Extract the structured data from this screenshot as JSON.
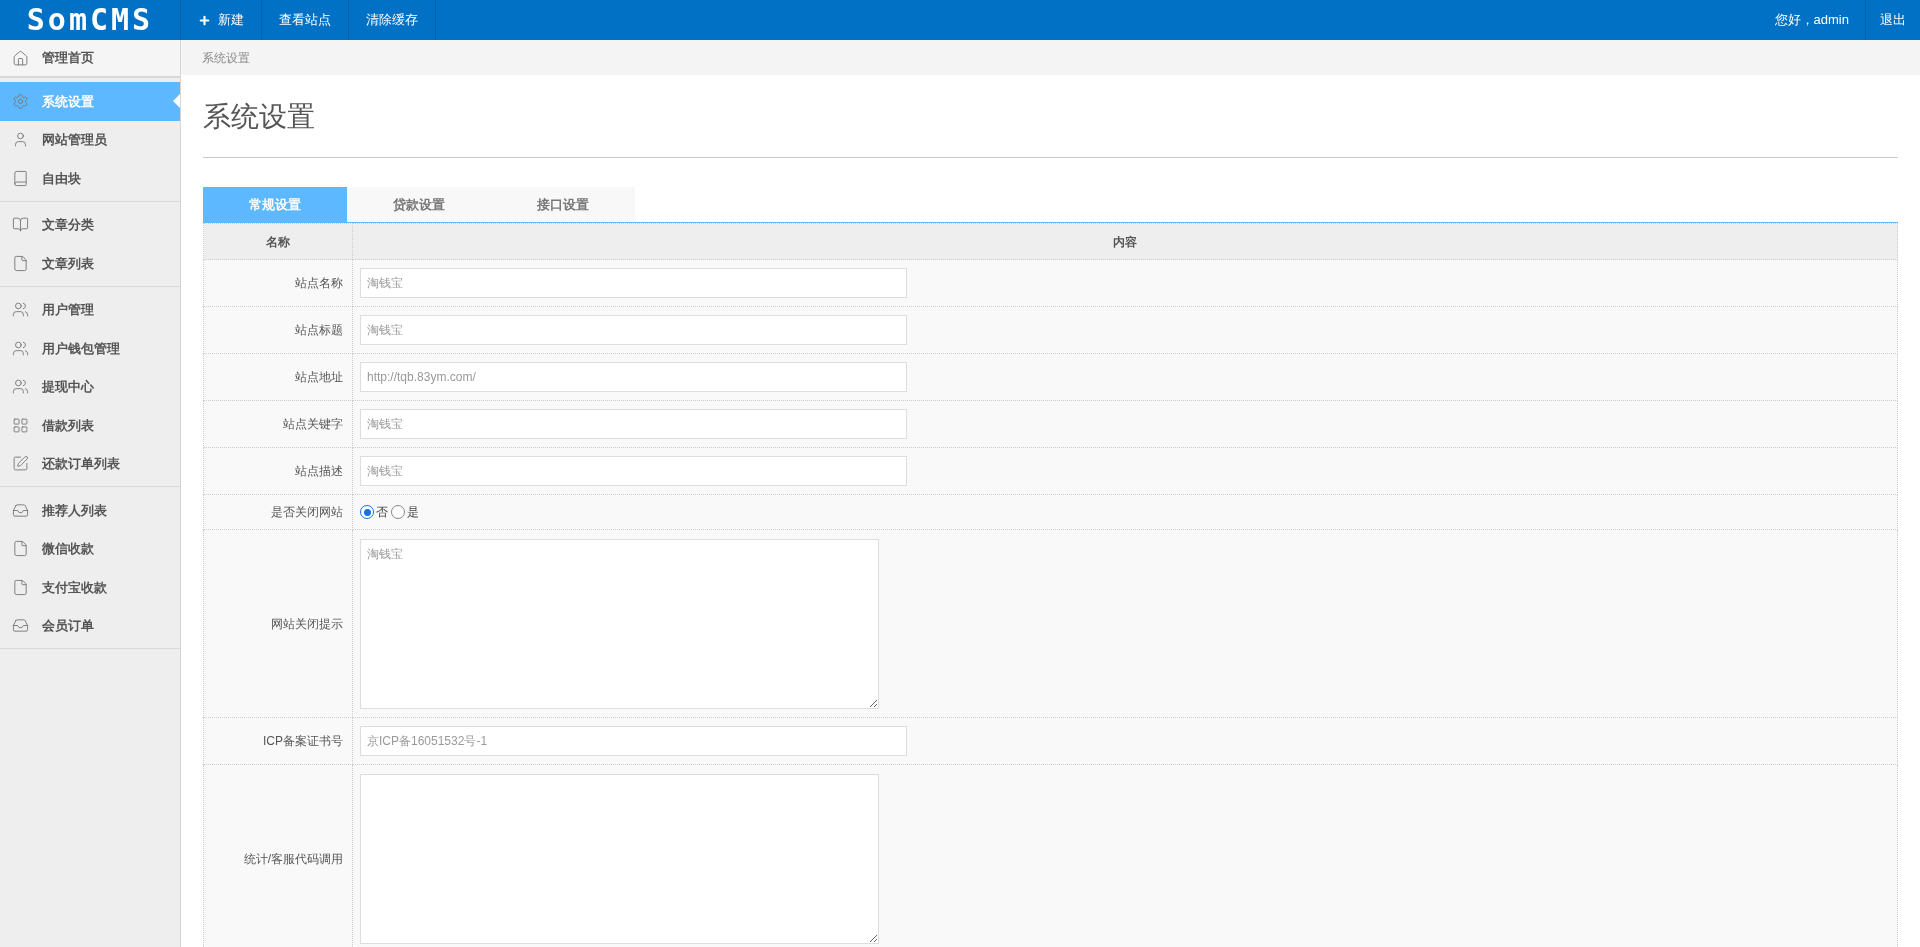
{
  "top_bar": {
    "logo": "SomCMS",
    "nav": [
      {
        "label": "新建",
        "kind": "add"
      },
      {
        "label": "查看站点",
        "kind": "link"
      },
      {
        "label": "清除缓存",
        "kind": "link"
      }
    ],
    "greeting": "您好，admin",
    "logout": "退出"
  },
  "sidebar": {
    "groups": [
      [
        {
          "label": "管理首页",
          "selected": false
        }
      ],
      [
        {
          "label": "系统设置",
          "selected": true
        },
        {
          "label": "网站管理员",
          "selected": false
        },
        {
          "label": "自由块",
          "selected": false
        }
      ],
      [
        {
          "label": "文章分类",
          "selected": false
        },
        {
          "label": "文章列表",
          "selected": false
        }
      ],
      [
        {
          "label": "用户管理",
          "selected": false
        },
        {
          "label": "用户钱包管理",
          "selected": false
        },
        {
          "label": "提现中心",
          "selected": false
        },
        {
          "label": "借款列表",
          "selected": false
        },
        {
          "label": "还款订单列表",
          "selected": false
        }
      ],
      [
        {
          "label": "推荐人列表",
          "selected": false
        },
        {
          "label": "微信收款",
          "selected": false
        },
        {
          "label": "支付宝收款",
          "selected": false
        },
        {
          "label": "会员订单",
          "selected": false
        }
      ]
    ]
  },
  "breadcrumb": "系统设置",
  "page_title": "系统设置",
  "tabs": [
    {
      "label": "常规设置",
      "selected": true
    },
    {
      "label": "贷款设置",
      "selected": false
    },
    {
      "label": "接口设置",
      "selected": false
    }
  ],
  "table": {
    "columns": [
      "名称",
      "内容"
    ],
    "rows": [
      {
        "label": "站点名称",
        "kind": "input",
        "value": "淘钱宝"
      },
      {
        "label": "站点标题",
        "kind": "input",
        "value": "淘钱宝"
      },
      {
        "label": "站点地址",
        "kind": "input",
        "value": "http://tqb.83ym.com/"
      },
      {
        "label": "站点关键字",
        "kind": "input",
        "value": "淘钱宝"
      },
      {
        "label": "站点描述",
        "kind": "input",
        "value": "淘钱宝"
      },
      {
        "label": "是否关闭网站",
        "kind": "radio",
        "options": [
          {
            "label": "否",
            "selected": true
          },
          {
            "label": "是",
            "selected": false
          }
        ]
      },
      {
        "label": "网站关闭提示",
        "kind": "textarea",
        "value": "淘钱宝"
      },
      {
        "label": "ICP备案证书号",
        "kind": "input",
        "value": "京ICP备16051532号-1"
      },
      {
        "label": "统计/客服代码调用",
        "kind": "textarea"
      }
    ]
  }
}
